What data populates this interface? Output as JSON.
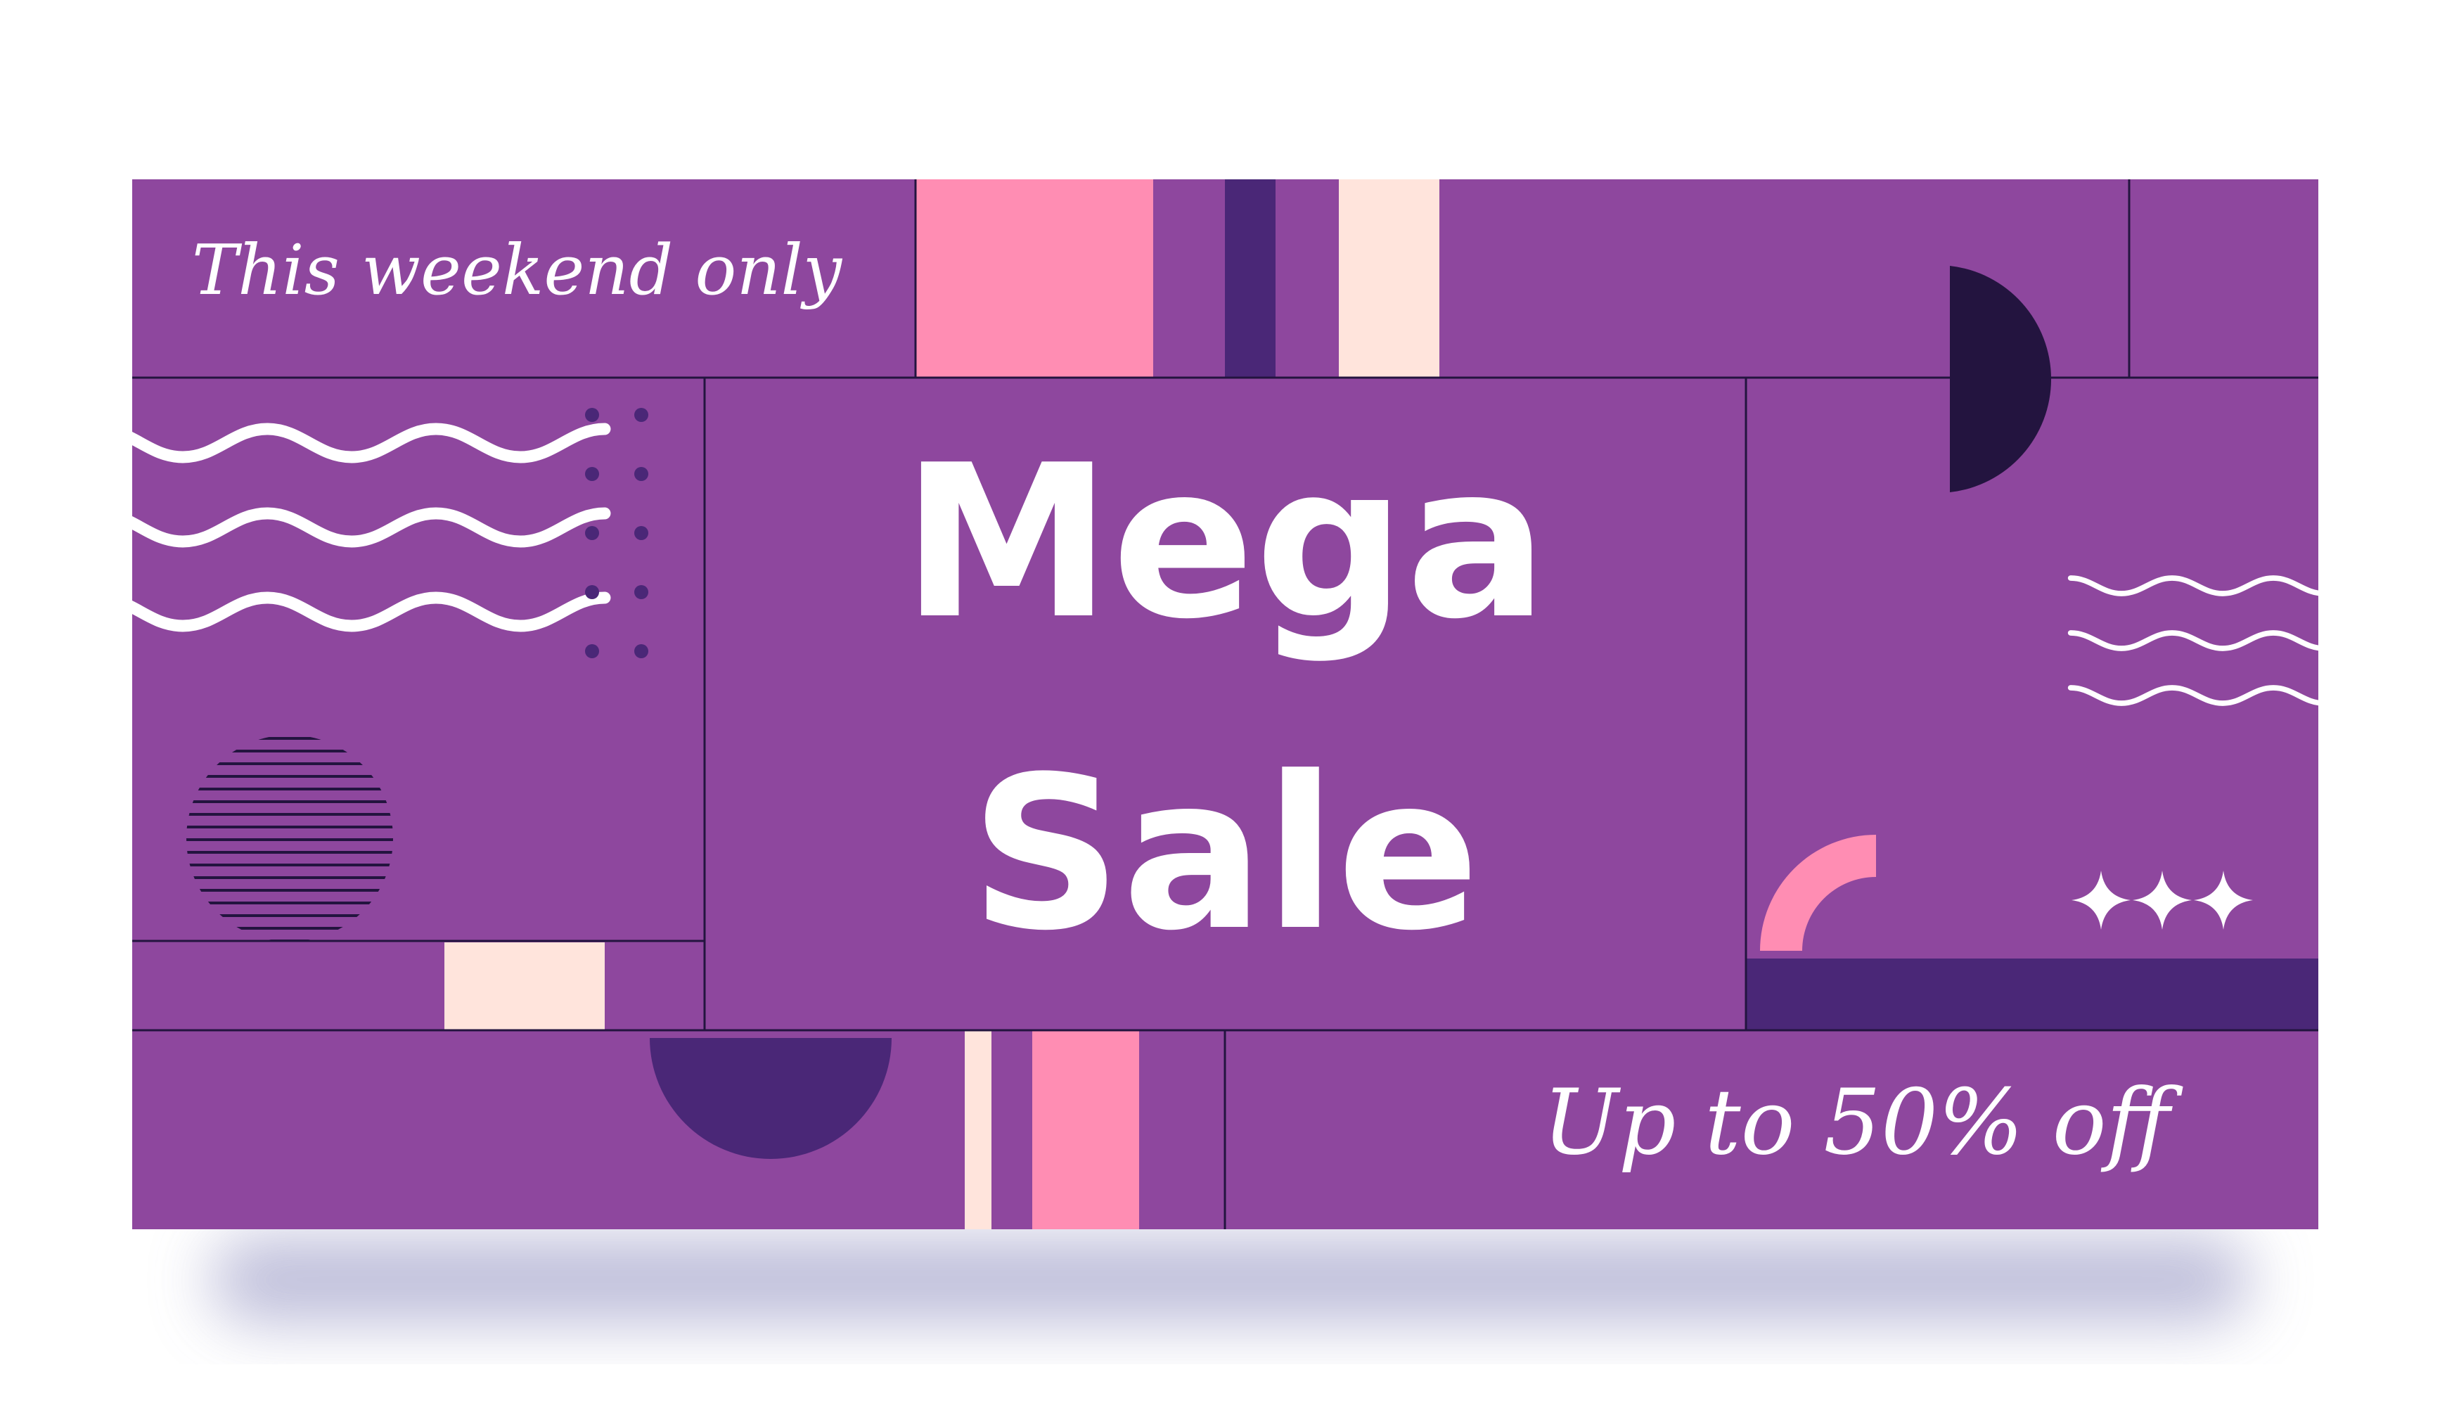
{
  "banner": {
    "tagline": "This weekend only",
    "headline_line1": "Mega",
    "headline_line2": "Sale",
    "offer": "Up to 50% off"
  },
  "colors": {
    "background": "#ffffff",
    "banner_purple": "#8e479e",
    "dark_purple": "#4a2777",
    "navy": "#23143f",
    "pink": "#ff8db3",
    "cream": "#ffe4dc",
    "white": "#ffffff",
    "shadow": "#9e9ec7"
  },
  "icons": [
    "wave-pattern-icon",
    "dot-grid-icon",
    "striped-circle-icon",
    "half-circle-icon",
    "quarter-ring-icon",
    "sparkle-icon"
  ]
}
